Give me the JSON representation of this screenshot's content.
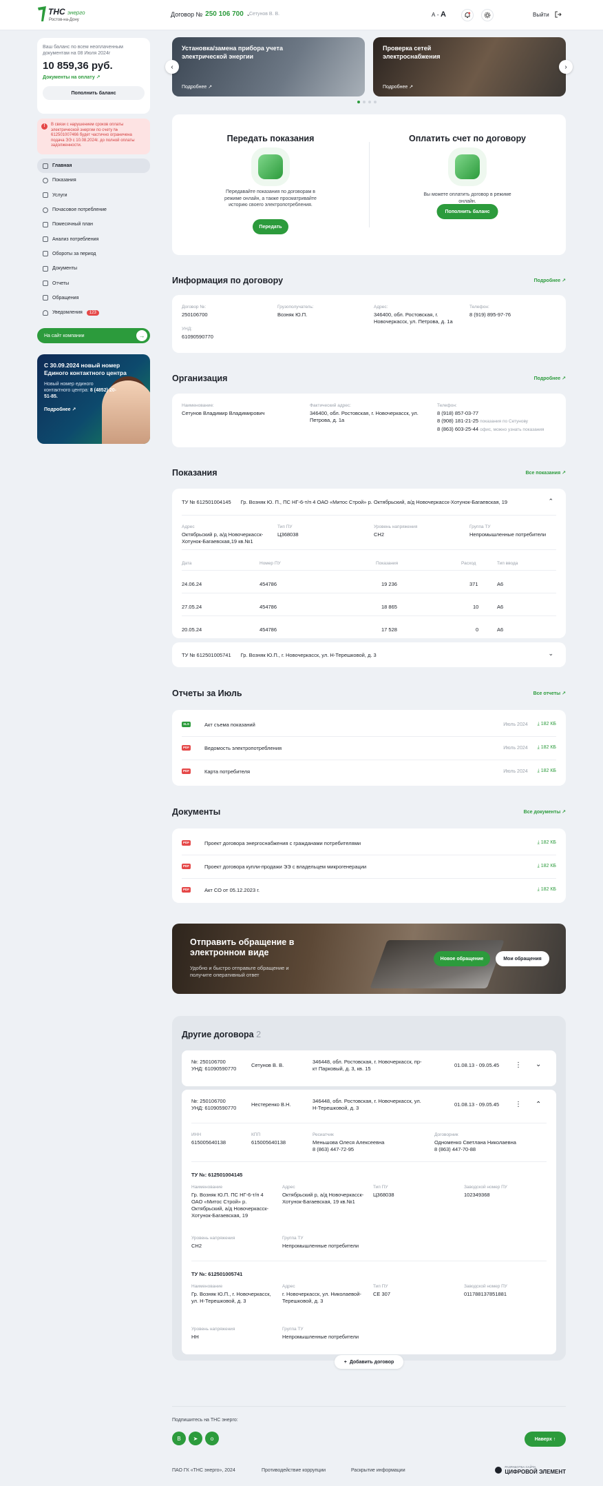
{
  "colors": {
    "accent": "#2c9b3c",
    "danger": "#e54848",
    "bg": "#eef1f5"
  },
  "header": {
    "logo_name": "ТНС",
    "logo_sub": "энерго",
    "logo_city": "Ростов-на-Дону",
    "contract_label": "Договор №",
    "contract_number": "250 106 700",
    "owner": "Сетунов В. В.",
    "font_size_small": "A",
    "font_size_sep": "-",
    "font_size_big": "A",
    "exit_label": "Выйти"
  },
  "balance": {
    "note": "Ваш баланс по всем неоплаченным документам на 08 Июля 2024г",
    "amount": "10 859,36 руб.",
    "docs_link": "Документы на оплату",
    "topup_label": "Пополнить баланс"
  },
  "warning": {
    "text": "В связи с нарушением сроков оплаты электрической энергии по счету № 612501007466 будет частично ограничена подача ЭЭ с 10.08.2024г. до полной оплаты задолженности."
  },
  "nav": {
    "items": [
      {
        "label": "Главная",
        "icon": "home-icon"
      },
      {
        "label": "Показания",
        "icon": "meter-icon"
      },
      {
        "label": "Услуги",
        "icon": "services-icon"
      },
      {
        "label": "Почасовое потребление",
        "icon": "clock-icon"
      },
      {
        "label": "Помесячный план",
        "icon": "calendar-icon"
      },
      {
        "label": "Анализ потребления",
        "icon": "chart-icon"
      },
      {
        "label": "Обороты за период",
        "icon": "turnover-icon"
      },
      {
        "label": "Документы",
        "icon": "document-icon"
      },
      {
        "label": "Отчеты",
        "icon": "report-icon"
      },
      {
        "label": "Обращения",
        "icon": "mail-icon"
      },
      {
        "label": "Уведомления",
        "icon": "bell-icon",
        "badge": "123"
      }
    ]
  },
  "site_button": {
    "label": "На сайт компании"
  },
  "promo": {
    "title": "С 30.09.2024 новый номер Единого контактного центра",
    "text": "Новый номер единого контактного центра:",
    "phone": "8 (4852) 20-51-85.",
    "more": "Подробнее"
  },
  "slides": [
    {
      "title": "Установка/замена прибора учета электрической энергии",
      "link": "Подробнее"
    },
    {
      "title": "Проверка сетей электроснабжения",
      "link": "Подробнее"
    }
  ],
  "actions": {
    "submit": {
      "title": "Передать показания",
      "text": "Передавайте показания по договорам в режиме онлайн, а также просматривайте историю своего электропотребления.",
      "button": "Передать"
    },
    "pay": {
      "title": "Оплатить счет по договору",
      "text": "Вы можете оплатить договор в режиме онлайн.",
      "button": "Пополнить баланс"
    }
  },
  "contract_info": {
    "title": "Информация по договору",
    "more": "Подробнее",
    "fields": [
      {
        "label": "Договор №:",
        "value": "250106700"
      },
      {
        "label": "Грузополучатель:",
        "value": "Возняк Ю.П."
      },
      {
        "label": "Адрес:",
        "value": "346400, обл. Ростовская, г. Новочеркасск, ул. Петрова, д. 1а"
      },
      {
        "label": "Телефон:",
        "value": "8 (919) 895-97-76"
      },
      {
        "label": "УНД:",
        "value": "61090590770"
      }
    ]
  },
  "organization": {
    "title": "Организация",
    "more": "Подробнее",
    "name_label": "Наименование:",
    "name": "Сетунов Владимир Владимирович",
    "addr_label": "Фактический адрес:",
    "addr": "346400, обл. Ростовская, г. Новочеркасск, ул. Петрова, д. 1а",
    "phone_label": "Телефон:",
    "phones": [
      {
        "number": "8 (918) 857-03-77",
        "note": ""
      },
      {
        "number": "8 (908) 181-21-25",
        "note": "показания по Сетунову"
      },
      {
        "number": "8 (863) 603-25-44",
        "note": "офис, можно узнать показания"
      }
    ]
  },
  "readings": {
    "title": "Показания",
    "more": "Все показания",
    "tu1": {
      "number": "ТУ № 612501004145",
      "desc": "Гр. Возняк Ю. П., ПС НГ-6-т/п 4 ОАО «Митос Строй» р. Октябрьский, а/д Новочеркасск-Хотунок-Багаевская, 19",
      "addr_label": "Адрес",
      "addr": "Октябрьский р, а/д Новочеркасск-Хотунок-Багаевская,19 кв.№1",
      "type_label": "Тип ПУ",
      "type": "Ц368038",
      "volt_label": "Уровень напряжения",
      "volt": "СН2",
      "group_label": "Группа ТУ",
      "group": "Непромышленные потребители",
      "cols": [
        "Дата",
        "Номер ПУ",
        "Показания",
        "Расход",
        "Тип ввода"
      ],
      "rows": [
        {
          "date": "24.06.24",
          "pu": "454786",
          "value": "19 236",
          "use": "371",
          "type": "А6"
        },
        {
          "date": "27.05.24",
          "pu": "454786",
          "value": "18 865",
          "use": "10",
          "type": "А6"
        },
        {
          "date": "20.05.24",
          "pu": "454786",
          "value": "17 528",
          "use": "0",
          "type": "А6"
        }
      ]
    },
    "tu2": {
      "number": "ТУ № 612501005741",
      "desc": "Гр. Возняк Ю.П., г. Новочеркасск, ул. Н-Терешковой, д. 3"
    }
  },
  "reports": {
    "title": "Отчеты за Июль",
    "more": "Все отчеты",
    "items": [
      {
        "type": "XLS",
        "name": "Акт съема показаний",
        "date": "Июль 2024",
        "size": "182 КБ"
      },
      {
        "type": "PDF",
        "name": "Ведомость электропотребления",
        "date": "Июль 2024",
        "size": "182 КБ"
      },
      {
        "type": "PDF",
        "name": "Карта потребителя",
        "date": "Июль 2024",
        "size": "182 КБ"
      }
    ]
  },
  "documents": {
    "title": "Документы",
    "more": "Все документы",
    "items": [
      {
        "type": "PDF",
        "name": "Проект договора энергоснабжения с гражданами потребителями",
        "size": "182 КБ"
      },
      {
        "type": "PDF",
        "name": "Проект договора купли-продажи ЭЭ с владельцем микрогенерации",
        "size": "182 КБ"
      },
      {
        "type": "PDF",
        "name": "Акт СО от 05.12.2023 г.",
        "size": "182 КБ"
      }
    ]
  },
  "appeal_banner": {
    "title": "Отправить обращение в электронном виде",
    "text": "Удобно и быстро отправьте обращение и получите оперативный ответ",
    "new_button": "Новое обращение",
    "my_button": "Мои обращения"
  },
  "other_contracts": {
    "title": "Другие договора",
    "count": "2",
    "c1": {
      "num": "№: 250106700",
      "und": "УНД: 61090590770",
      "owner": "Сетунов В. В.",
      "addr": "346448, обл. Ростовская, г. Новочеркасск, пр-кт Парковый, д. 3, кв. 15",
      "period": "01.08.13 - 09.05.45"
    },
    "c2": {
      "num": "№: 250106700",
      "und": "УНД: 61090590770",
      "owner": "Нестеренко В.Н.",
      "addr": "346448, обл. Ростовская, г. Новочеркасск, ул. Н-Терешковой, д. 3",
      "period": "01.08.13 - 09.05.45",
      "inn_label": "ИНН",
      "inn": "615005640138",
      "kpp_label": "КПП",
      "kpp": "615005640138",
      "res_label": "Ресиатчик",
      "res": "Меньшова Олеся Алексеевна",
      "res_phone": "8 (863) 447-72-95",
      "dog_label": "Договорник",
      "dog": "Одноменко Светлана Николаевна",
      "dog_phone": "8 (863) 447-70-88",
      "tu1": {
        "title": "ТУ №: 612501004145",
        "name_label": "Наименование",
        "name": "Гр. Возняк Ю.П. ПС НГ-6-т/п 4 ОАО «Митос Строй» р. Октябрьский, а/д Новочеркасск-Хотунок-Багаевская, 19",
        "addr_label": "Адрес",
        "addr": "Октябрьский р, а/д Новочеркасск-Хотунок-Багаевская, 19 кв.№1",
        "type_label": "Тип ПУ",
        "type": "Ц368038",
        "fn_label": "Заводской номер ПУ",
        "fn": "102349368",
        "volt_label": "Уровень напряжения",
        "volt": "СН2",
        "group_label": "Группа ТУ",
        "group": "Непромышленные потребители"
      },
      "tu2": {
        "title": "ТУ №: 612501005741",
        "name_label": "Наименование",
        "name": "Гр. Возняк Ю.П., г. Новочеркасск, ул. Н-Терешковой, д. 3",
        "addr_label": "Адрес",
        "addr": "г. Новочеркасск, ул. Николаевой-Терешковой, д. 3",
        "type_label": "Тип ПУ",
        "type": "СЕ 307",
        "fn_label": "Заводской номер ПУ",
        "fn": "011788137851881",
        "volt_label": "Уровень напряжения",
        "volt": "НН",
        "group_label": "Группа ТУ",
        "group": "Непромышленные потребители"
      }
    },
    "add_button": "Добавить договор"
  },
  "footer": {
    "subscribe": "Подпишитесь на ТНС энерго:",
    "up_button": "Наверх",
    "copyright": "ПАО ГК «ТНС энерго», 2024",
    "corruption": "Противодействие коррупции",
    "disclosure": "Раскрытие информации",
    "dev_small": "РАЗРАБОТКА САЙТА",
    "dev_name": "ЦИФРОВОЙ ЭЛЕМЕНТ"
  }
}
